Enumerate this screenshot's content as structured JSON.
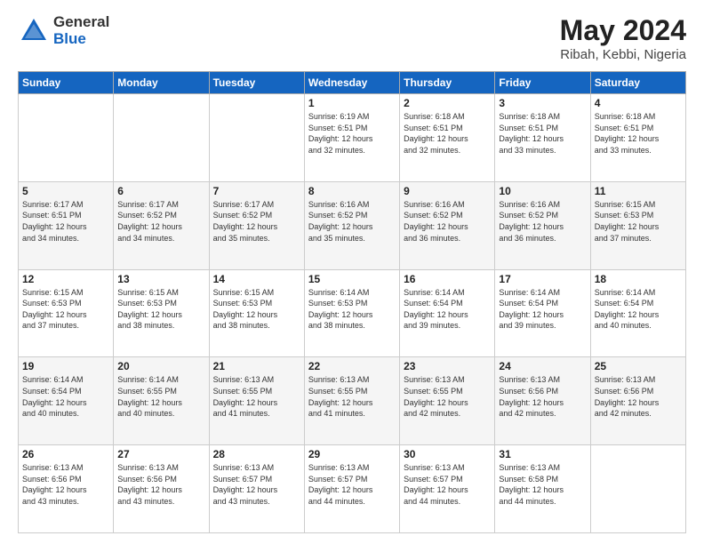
{
  "header": {
    "logo_general": "General",
    "logo_blue": "Blue",
    "title": "May 2024",
    "subtitle": "Ribah, Kebbi, Nigeria"
  },
  "days_of_week": [
    "Sunday",
    "Monday",
    "Tuesday",
    "Wednesday",
    "Thursday",
    "Friday",
    "Saturday"
  ],
  "weeks": [
    [
      {
        "day": "",
        "info": ""
      },
      {
        "day": "",
        "info": ""
      },
      {
        "day": "",
        "info": ""
      },
      {
        "day": "1",
        "info": "Sunrise: 6:19 AM\nSunset: 6:51 PM\nDaylight: 12 hours\nand 32 minutes."
      },
      {
        "day": "2",
        "info": "Sunrise: 6:18 AM\nSunset: 6:51 PM\nDaylight: 12 hours\nand 32 minutes."
      },
      {
        "day": "3",
        "info": "Sunrise: 6:18 AM\nSunset: 6:51 PM\nDaylight: 12 hours\nand 33 minutes."
      },
      {
        "day": "4",
        "info": "Sunrise: 6:18 AM\nSunset: 6:51 PM\nDaylight: 12 hours\nand 33 minutes."
      }
    ],
    [
      {
        "day": "5",
        "info": "Sunrise: 6:17 AM\nSunset: 6:51 PM\nDaylight: 12 hours\nand 34 minutes."
      },
      {
        "day": "6",
        "info": "Sunrise: 6:17 AM\nSunset: 6:52 PM\nDaylight: 12 hours\nand 34 minutes."
      },
      {
        "day": "7",
        "info": "Sunrise: 6:17 AM\nSunset: 6:52 PM\nDaylight: 12 hours\nand 35 minutes."
      },
      {
        "day": "8",
        "info": "Sunrise: 6:16 AM\nSunset: 6:52 PM\nDaylight: 12 hours\nand 35 minutes."
      },
      {
        "day": "9",
        "info": "Sunrise: 6:16 AM\nSunset: 6:52 PM\nDaylight: 12 hours\nand 36 minutes."
      },
      {
        "day": "10",
        "info": "Sunrise: 6:16 AM\nSunset: 6:52 PM\nDaylight: 12 hours\nand 36 minutes."
      },
      {
        "day": "11",
        "info": "Sunrise: 6:15 AM\nSunset: 6:53 PM\nDaylight: 12 hours\nand 37 minutes."
      }
    ],
    [
      {
        "day": "12",
        "info": "Sunrise: 6:15 AM\nSunset: 6:53 PM\nDaylight: 12 hours\nand 37 minutes."
      },
      {
        "day": "13",
        "info": "Sunrise: 6:15 AM\nSunset: 6:53 PM\nDaylight: 12 hours\nand 38 minutes."
      },
      {
        "day": "14",
        "info": "Sunrise: 6:15 AM\nSunset: 6:53 PM\nDaylight: 12 hours\nand 38 minutes."
      },
      {
        "day": "15",
        "info": "Sunrise: 6:14 AM\nSunset: 6:53 PM\nDaylight: 12 hours\nand 38 minutes."
      },
      {
        "day": "16",
        "info": "Sunrise: 6:14 AM\nSunset: 6:54 PM\nDaylight: 12 hours\nand 39 minutes."
      },
      {
        "day": "17",
        "info": "Sunrise: 6:14 AM\nSunset: 6:54 PM\nDaylight: 12 hours\nand 39 minutes."
      },
      {
        "day": "18",
        "info": "Sunrise: 6:14 AM\nSunset: 6:54 PM\nDaylight: 12 hours\nand 40 minutes."
      }
    ],
    [
      {
        "day": "19",
        "info": "Sunrise: 6:14 AM\nSunset: 6:54 PM\nDaylight: 12 hours\nand 40 minutes."
      },
      {
        "day": "20",
        "info": "Sunrise: 6:14 AM\nSunset: 6:55 PM\nDaylight: 12 hours\nand 40 minutes."
      },
      {
        "day": "21",
        "info": "Sunrise: 6:13 AM\nSunset: 6:55 PM\nDaylight: 12 hours\nand 41 minutes."
      },
      {
        "day": "22",
        "info": "Sunrise: 6:13 AM\nSunset: 6:55 PM\nDaylight: 12 hours\nand 41 minutes."
      },
      {
        "day": "23",
        "info": "Sunrise: 6:13 AM\nSunset: 6:55 PM\nDaylight: 12 hours\nand 42 minutes."
      },
      {
        "day": "24",
        "info": "Sunrise: 6:13 AM\nSunset: 6:56 PM\nDaylight: 12 hours\nand 42 minutes."
      },
      {
        "day": "25",
        "info": "Sunrise: 6:13 AM\nSunset: 6:56 PM\nDaylight: 12 hours\nand 42 minutes."
      }
    ],
    [
      {
        "day": "26",
        "info": "Sunrise: 6:13 AM\nSunset: 6:56 PM\nDaylight: 12 hours\nand 43 minutes."
      },
      {
        "day": "27",
        "info": "Sunrise: 6:13 AM\nSunset: 6:56 PM\nDaylight: 12 hours\nand 43 minutes."
      },
      {
        "day": "28",
        "info": "Sunrise: 6:13 AM\nSunset: 6:57 PM\nDaylight: 12 hours\nand 43 minutes."
      },
      {
        "day": "29",
        "info": "Sunrise: 6:13 AM\nSunset: 6:57 PM\nDaylight: 12 hours\nand 44 minutes."
      },
      {
        "day": "30",
        "info": "Sunrise: 6:13 AM\nSunset: 6:57 PM\nDaylight: 12 hours\nand 44 minutes."
      },
      {
        "day": "31",
        "info": "Sunrise: 6:13 AM\nSunset: 6:58 PM\nDaylight: 12 hours\nand 44 minutes."
      },
      {
        "day": "",
        "info": ""
      }
    ]
  ]
}
